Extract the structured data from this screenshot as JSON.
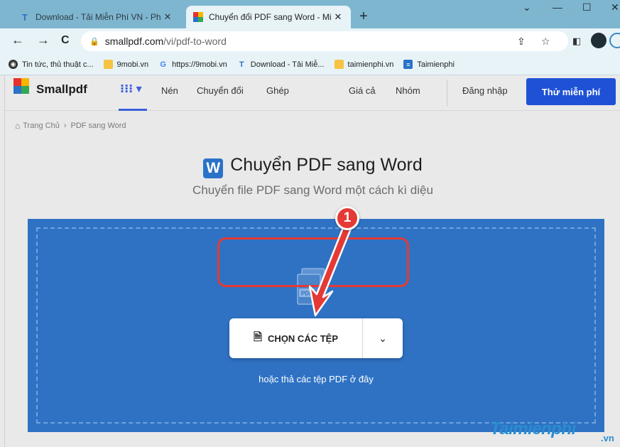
{
  "browser": {
    "tabs": [
      {
        "title": "Download - Tải Miễn Phí VN - Ph",
        "favicon": "T",
        "close": "✕"
      },
      {
        "title": "Chuyển đổi PDF sang Word - Mi",
        "favicon": "smallpdf-logo",
        "close": "✕"
      }
    ],
    "new_tab": "+",
    "window_controls": {
      "chevron": "⌄",
      "minimize": "—",
      "maximize": "☐",
      "close": "✕"
    },
    "url_host": "smallpdf.com",
    "url_path": "/vi/pdf-to-word",
    "nav": {
      "back": "←",
      "forward": "→",
      "reload": "C"
    },
    "bookmarks": [
      {
        "label": "Tin tức, thủ thuật c...",
        "icon": "globe-icon"
      },
      {
        "label": "9mobi.vn",
        "icon": "folder-icon"
      },
      {
        "label": "https://9mobi.vn",
        "icon": "G"
      },
      {
        "label": "Download - Tải Miễ...",
        "icon": "T"
      },
      {
        "label": "taimienphi.vn",
        "icon": "folder-icon"
      },
      {
        "label": "Taimienphi",
        "icon": "doc-icon"
      }
    ]
  },
  "site": {
    "logo": "Smallpdf",
    "nav": [
      "Nén",
      "Chuyển đổi",
      "Ghép",
      "Giá cả",
      "Nhóm",
      "Đăng nhập"
    ],
    "cta": "Thử miễn phí",
    "breadcrumb": {
      "home": "Trang Chủ",
      "sep": "›",
      "current": "PDF sang Word"
    },
    "title_badge": "W",
    "title": "Chuyển PDF sang Word",
    "subtitle": "Chuyển file PDF sang Word một cách kì diệu",
    "choose_files": "CHỌN CÁC TỆP",
    "drop_hint": "hoặc thả các tệp PDF ở đây",
    "step_number": "1",
    "file_badge": "PDF"
  },
  "watermark": {
    "main": "Taimienphi",
    "suffix": ".vn"
  },
  "colors": {
    "tabstrip": "#7fb6cf",
    "dropzone": "#2f72c4",
    "cta": "#1f51d6",
    "annotation": "#e53935"
  }
}
